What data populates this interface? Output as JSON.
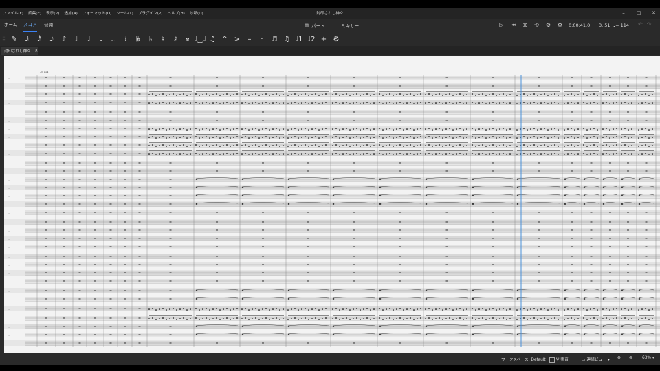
{
  "window": {
    "title": "封印されし神々"
  },
  "menu": [
    "ファイル(F)",
    "編集(E)",
    "表示(V)",
    "追加(A)",
    "フォーマット(O)",
    "ツール(T)",
    "プラグイン(P)",
    "ヘルプ(H)",
    "診断(D)"
  ],
  "window_controls": {
    "minimize": "–",
    "maximize": "□",
    "close": "✕"
  },
  "tabs": {
    "home": "ホーム",
    "score": "スコア",
    "publish": "公開",
    "parts": "パート",
    "mixer": "ミキサー"
  },
  "playback": {
    "icons": [
      "play-icon",
      "rewind-icon",
      "metronome-icon",
      "loop-icon",
      "playback-settings-icon"
    ],
    "time": "0:00:41.0",
    "position": "3. 51",
    "tempo": "♩= 114"
  },
  "toolbar": [
    {
      "name": "grip",
      "glyph": "⠿"
    },
    {
      "name": "note-input",
      "glyph": "✎"
    },
    {
      "name": "64th-note",
      "glyph": "𝅘𝅥𝅱"
    },
    {
      "name": "32nd-note",
      "glyph": "𝅘𝅥𝅰"
    },
    {
      "name": "16th-note",
      "glyph": "𝅘𝅥𝅯"
    },
    {
      "name": "eighth-note",
      "glyph": "♪"
    },
    {
      "name": "quarter-note",
      "glyph": "♩"
    },
    {
      "name": "half-note",
      "glyph": "𝅗𝅥"
    },
    {
      "name": "whole-note",
      "glyph": "𝅝"
    },
    {
      "name": "augmentation-dot",
      "glyph": "♩."
    },
    {
      "name": "rest",
      "glyph": "𝄽"
    },
    {
      "name": "double-flat",
      "glyph": "𝄫"
    },
    {
      "name": "flat",
      "glyph": "♭"
    },
    {
      "name": "natural",
      "glyph": "♮"
    },
    {
      "name": "sharp",
      "glyph": "♯"
    },
    {
      "name": "double-sharp",
      "glyph": "𝄪"
    },
    {
      "name": "tie",
      "glyph": "♩‿♩"
    },
    {
      "name": "slur",
      "glyph": "♫"
    },
    {
      "name": "marcato",
      "glyph": "^"
    },
    {
      "name": "accent",
      "glyph": ">"
    },
    {
      "name": "tenuto",
      "glyph": "–"
    },
    {
      "name": "staccato",
      "glyph": "·"
    },
    {
      "name": "tuplet",
      "glyph": "♬"
    },
    {
      "name": "beam",
      "glyph": "♫"
    },
    {
      "name": "voice-1",
      "glyph": "♩1"
    },
    {
      "name": "voice-2",
      "glyph": "♩2"
    },
    {
      "name": "add",
      "glyph": "+"
    },
    {
      "name": "customize",
      "glyph": "⚙"
    }
  ],
  "document_tab": {
    "label": "封印されし神々",
    "close": "✕"
  },
  "status": {
    "workspace": "ワークスペース: Default",
    "concert_pitch": "実音",
    "view_mode": "連続ビュー",
    "zoom": "63%"
  },
  "colors": {
    "accent": "#3b82f6",
    "playhead": "#4a90d9",
    "paper": "#f3f3f3"
  }
}
